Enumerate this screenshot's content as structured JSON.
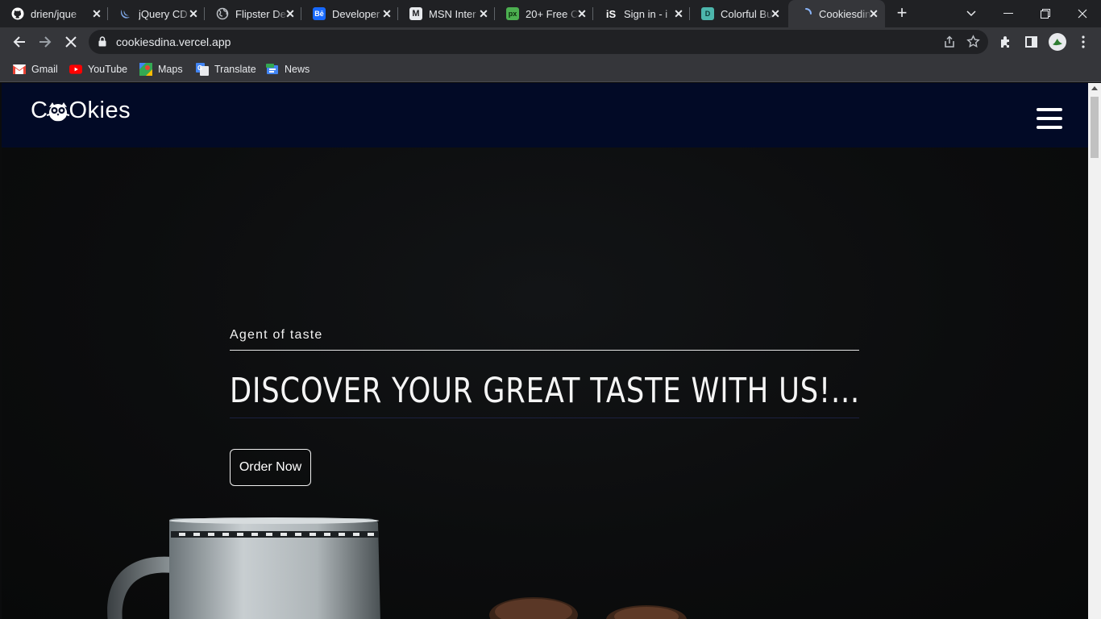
{
  "browser": {
    "tabs": [
      {
        "title": "drien/jque",
        "icon": "github-icon",
        "color": "#ffffff",
        "active": false
      },
      {
        "title": "jQuery CD",
        "icon": "jquery-icon",
        "color": "#7fa8e8",
        "active": false
      },
      {
        "title": "Flipster De",
        "icon": "globe-icon",
        "color": "#bdc1c6",
        "active": false
      },
      {
        "title": "Developer",
        "icon": "behance-icon",
        "color": "#1769ff",
        "active": false
      },
      {
        "title": "MSN Inter",
        "icon": "msn-icon",
        "color": "#e8eaed",
        "active": false
      },
      {
        "title": "20+ Free C",
        "icon": "px-icon",
        "color": "#4caf50",
        "active": false
      },
      {
        "title": "Sign in - i",
        "icon": "is-icon",
        "color": "#ffffff",
        "active": false
      },
      {
        "title": "Colorful Bu",
        "icon": "d-icon",
        "color": "#4db6ac",
        "active": false
      },
      {
        "title": "Cookiesdin",
        "icon": "loading-icon",
        "color": "#8ab4f8",
        "active": true
      }
    ],
    "address": "cookiesdina.vercel.app",
    "bookmarks": [
      {
        "label": "Gmail",
        "icon": "gmail-icon"
      },
      {
        "label": "YouTube",
        "icon": "youtube-icon"
      },
      {
        "label": "Maps",
        "icon": "maps-icon"
      },
      {
        "label": "Translate",
        "icon": "translate-icon"
      },
      {
        "label": "News",
        "icon": "news-icon"
      }
    ]
  },
  "site": {
    "logo_prefix": "C",
    "logo_suffix": "Okies",
    "kicker": "Agent of taste",
    "headline": "DISCOVER YOUR GREAT TASTE WITH US!...",
    "cta": "Order Now",
    "nav_bg": "#020a26"
  }
}
